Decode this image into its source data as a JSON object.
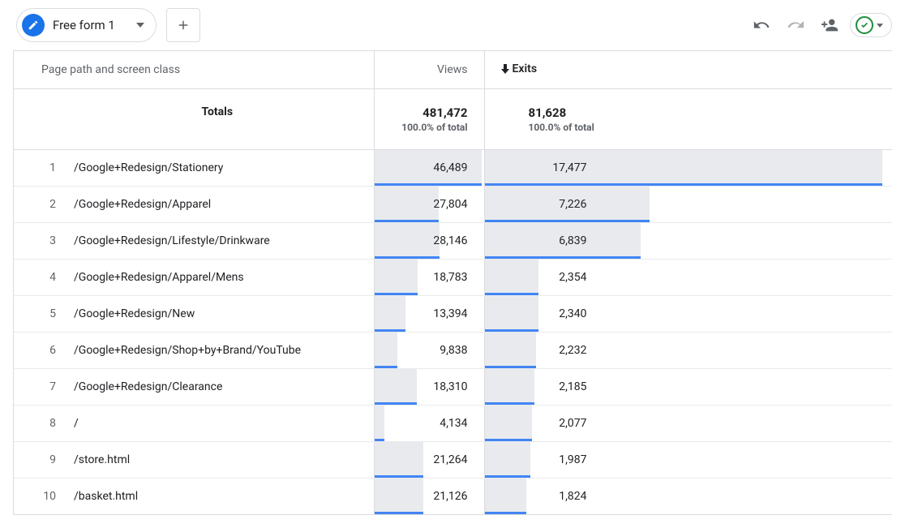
{
  "toolbar": {
    "tab_label": "Free form 1"
  },
  "icons": {
    "pencil": "pencil-icon",
    "caret": "caret-down-icon",
    "plus": "plus-icon",
    "undo": "undo-icon",
    "redo": "redo-icon",
    "share": "person-add-icon",
    "check": "checkmark-icon"
  },
  "table": {
    "dimension_header": "Page path and screen class",
    "metric_views_header": "Views",
    "metric_exits_header": "Exits",
    "sort_direction": "desc",
    "totals_label": "Totals",
    "totals": {
      "views": "481,472",
      "views_pct": "100.0% of total",
      "exits": "81,628",
      "exits_pct": "100.0% of total"
    },
    "max_views": 46489,
    "max_exits": 17477,
    "rows": [
      {
        "n": "1",
        "path": "/Google+Redesign/Stationery",
        "views": "46,489",
        "views_n": 46489,
        "exits": "17,477",
        "exits_n": 17477
      },
      {
        "n": "2",
        "path": "/Google+Redesign/Apparel",
        "views": "27,804",
        "views_n": 27804,
        "exits": "7,226",
        "exits_n": 7226
      },
      {
        "n": "3",
        "path": "/Google+Redesign/Lifestyle/Drinkware",
        "views": "28,146",
        "views_n": 28146,
        "exits": "6,839",
        "exits_n": 6839
      },
      {
        "n": "4",
        "path": "/Google+Redesign/Apparel/Mens",
        "views": "18,783",
        "views_n": 18783,
        "exits": "2,354",
        "exits_n": 2354
      },
      {
        "n": "5",
        "path": "/Google+Redesign/New",
        "views": "13,394",
        "views_n": 13394,
        "exits": "2,340",
        "exits_n": 2340
      },
      {
        "n": "6",
        "path": "/Google+Redesign/Shop+by+Brand/YouTube",
        "views": "9,838",
        "views_n": 9838,
        "exits": "2,232",
        "exits_n": 2232
      },
      {
        "n": "7",
        "path": "/Google+Redesign/Clearance",
        "views": "18,310",
        "views_n": 18310,
        "exits": "2,185",
        "exits_n": 2185
      },
      {
        "n": "8",
        "path": "/",
        "views": "4,134",
        "views_n": 4134,
        "exits": "2,077",
        "exits_n": 2077
      },
      {
        "n": "9",
        "path": "/store.html",
        "views": "21,264",
        "views_n": 21264,
        "exits": "1,987",
        "exits_n": 1987
      },
      {
        "n": "10",
        "path": "/basket.html",
        "views": "21,126",
        "views_n": 21126,
        "exits": "1,824",
        "exits_n": 1824
      }
    ]
  },
  "colors": {
    "accent": "#1a73e8",
    "bar_fill": "#e8eaed",
    "bar_line": "#4285f4",
    "green": "#1e8e3e"
  }
}
